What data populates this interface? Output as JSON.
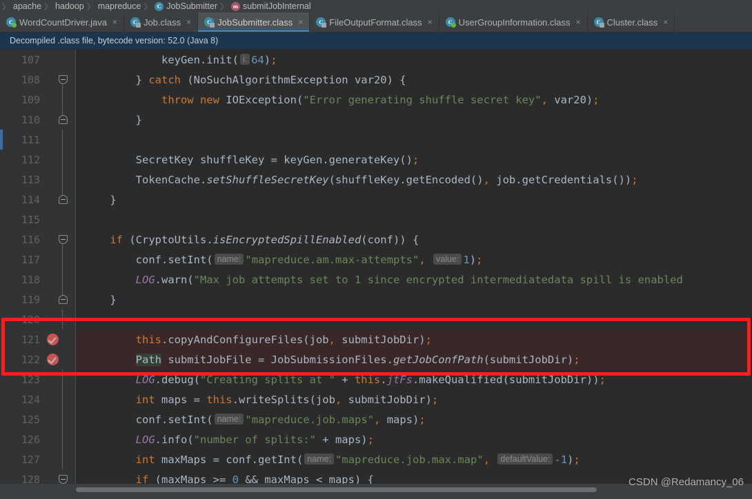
{
  "breadcrumb": {
    "items": [
      {
        "label": "apache",
        "icon": ""
      },
      {
        "label": "hadoop",
        "icon": ""
      },
      {
        "label": "mapreduce",
        "icon": ""
      },
      {
        "label": "JobSubmitter",
        "icon": "class-icon",
        "glyph": "C"
      },
      {
        "label": "submitJobInternal",
        "icon": "method-icon",
        "glyph": "m"
      }
    ],
    "separator": "〉"
  },
  "tabs": [
    {
      "label": "WordCountDriver.java",
      "icon": "java-class-icon",
      "glyph": "C",
      "badge": "green",
      "active": false,
      "close": "×"
    },
    {
      "label": "Job.class",
      "icon": "compiled-class-icon",
      "glyph": "C",
      "badge": "lock",
      "active": false,
      "close": "×"
    },
    {
      "label": "JobSubmitter.class",
      "icon": "compiled-class-icon",
      "glyph": "C",
      "badge": "lock",
      "active": true,
      "close": "×"
    },
    {
      "label": "FileOutputFormat.class",
      "icon": "compiled-class-icon",
      "glyph": "C",
      "badge": "lock",
      "active": false,
      "close": "×"
    },
    {
      "label": "UserGroupInformation.class",
      "icon": "compiled-class-icon",
      "glyph": "C",
      "badge": "green",
      "active": false,
      "close": "×"
    },
    {
      "label": "Cluster.class",
      "icon": "compiled-class-icon",
      "glyph": "C",
      "badge": "lock",
      "active": false,
      "close": "×"
    }
  ],
  "notification": {
    "text": "Decompiled .class file, bytecode version: 52.0 (Java 8)"
  },
  "editor": {
    "lines": [
      {
        "no": "107",
        "fold": "none",
        "bp": false,
        "vcs": false,
        "highlight": false,
        "tokens": [
          {
            "t": "            ",
            "c": "op"
          },
          {
            "t": "keyGen.init(",
            "c": "ident"
          },
          {
            "t": "i:",
            "c": "hint"
          },
          {
            "t": "64",
            "c": "num"
          },
          {
            "t": ")",
            "c": "ident"
          },
          {
            "t": ";",
            "c": "semi"
          }
        ]
      },
      {
        "no": "108",
        "fold": "start",
        "bp": false,
        "vcs": false,
        "highlight": false,
        "tokens": [
          {
            "t": "        } ",
            "c": "op"
          },
          {
            "t": "catch",
            "c": "kw"
          },
          {
            "t": " (NoSuchAlgorithmException var20) {",
            "c": "ident"
          }
        ]
      },
      {
        "no": "109",
        "fold": "line",
        "bp": false,
        "vcs": false,
        "highlight": false,
        "tokens": [
          {
            "t": "            ",
            "c": "op"
          },
          {
            "t": "throw new",
            "c": "kw"
          },
          {
            "t": " IOException(",
            "c": "ident"
          },
          {
            "t": "\"Error generating shuffle secret key\"",
            "c": "str"
          },
          {
            "t": ",",
            "c": "comma"
          },
          {
            "t": " var20)",
            "c": "ident"
          },
          {
            "t": ";",
            "c": "semi"
          }
        ]
      },
      {
        "no": "110",
        "fold": "end",
        "bp": false,
        "vcs": false,
        "highlight": false,
        "tokens": [
          {
            "t": "        }",
            "c": "op"
          }
        ]
      },
      {
        "no": "111",
        "fold": "line",
        "bp": false,
        "vcs": true,
        "highlight": false,
        "tokens": []
      },
      {
        "no": "112",
        "fold": "line",
        "bp": false,
        "vcs": false,
        "highlight": false,
        "tokens": [
          {
            "t": "        SecretKey shuffleKey = keyGen.generateKey()",
            "c": "ident"
          },
          {
            "t": ";",
            "c": "semi"
          }
        ]
      },
      {
        "no": "113",
        "fold": "line",
        "bp": false,
        "vcs": false,
        "highlight": false,
        "tokens": [
          {
            "t": "        TokenCache.",
            "c": "ident"
          },
          {
            "t": "setShuffleSecretKey",
            "c": "stat"
          },
          {
            "t": "(shuffleKey.getEncoded()",
            "c": "ident"
          },
          {
            "t": ",",
            "c": "comma"
          },
          {
            "t": " job.getCredentials())",
            "c": "ident"
          },
          {
            "t": ";",
            "c": "semi"
          }
        ]
      },
      {
        "no": "114",
        "fold": "end",
        "bp": false,
        "vcs": false,
        "highlight": false,
        "tokens": [
          {
            "t": "    }",
            "c": "op"
          }
        ]
      },
      {
        "no": "115",
        "fold": "none",
        "bp": false,
        "vcs": false,
        "highlight": false,
        "tokens": []
      },
      {
        "no": "116",
        "fold": "start",
        "bp": false,
        "vcs": false,
        "highlight": false,
        "tokens": [
          {
            "t": "    ",
            "c": "op"
          },
          {
            "t": "if",
            "c": "kw"
          },
          {
            "t": " (CryptoUtils.",
            "c": "ident"
          },
          {
            "t": "isEncryptedSpillEnabled",
            "c": "stat"
          },
          {
            "t": "(conf)) {",
            "c": "ident"
          }
        ]
      },
      {
        "no": "117",
        "fold": "line",
        "bp": false,
        "vcs": false,
        "highlight": false,
        "tokens": [
          {
            "t": "        conf.setInt(",
            "c": "ident"
          },
          {
            "t": "name:",
            "c": "hint"
          },
          {
            "t": "\"mapreduce.am.max-attempts\"",
            "c": "str"
          },
          {
            "t": ",",
            "c": "comma"
          },
          {
            "t": " ",
            "c": "op"
          },
          {
            "t": "value:",
            "c": "hint"
          },
          {
            "t": "1",
            "c": "num"
          },
          {
            "t": ")",
            "c": "ident"
          },
          {
            "t": ";",
            "c": "semi"
          }
        ]
      },
      {
        "no": "118",
        "fold": "line",
        "bp": false,
        "vcs": false,
        "highlight": false,
        "tokens": [
          {
            "t": "        ",
            "c": "op"
          },
          {
            "t": "LOG",
            "c": "field"
          },
          {
            "t": ".warn(",
            "c": "ident"
          },
          {
            "t": "\"Max job attempts set to 1 since encrypted intermediatedata spill is enabled",
            "c": "str"
          }
        ]
      },
      {
        "no": "119",
        "fold": "end",
        "bp": false,
        "vcs": false,
        "highlight": false,
        "tokens": [
          {
            "t": "    }",
            "c": "op"
          }
        ]
      },
      {
        "no": "120",
        "fold": "line",
        "bp": false,
        "vcs": false,
        "highlight": false,
        "tokens": []
      },
      {
        "no": "121",
        "fold": "none",
        "bp": true,
        "vcs": false,
        "highlight": true,
        "tokens": [
          {
            "t": "        ",
            "c": "op"
          },
          {
            "t": "this",
            "c": "kw"
          },
          {
            "t": ".copyAndConfigureFiles(job",
            "c": "ident"
          },
          {
            "t": ",",
            "c": "comma"
          },
          {
            "t": " submitJobDir)",
            "c": "ident"
          },
          {
            "t": ";",
            "c": "semi"
          }
        ]
      },
      {
        "no": "122",
        "fold": "none",
        "bp": true,
        "vcs": false,
        "highlight": true,
        "tokens": [
          {
            "t": "        ",
            "c": "op"
          },
          {
            "t": "Path",
            "c": "greenhl"
          },
          {
            "t": " submitJobFile = JobSubmissionFiles.",
            "c": "ident"
          },
          {
            "t": "getJobConfPath",
            "c": "stat"
          },
          {
            "t": "(submitJobDir)",
            "c": "ident"
          },
          {
            "t": ";",
            "c": "semi"
          }
        ]
      },
      {
        "no": "123",
        "fold": "line",
        "bp": false,
        "vcs": false,
        "highlight": false,
        "tokens": [
          {
            "t": "        ",
            "c": "op"
          },
          {
            "t": "LOG",
            "c": "field"
          },
          {
            "t": ".debug(",
            "c": "ident"
          },
          {
            "t": "\"Creating splits at \"",
            "c": "str"
          },
          {
            "t": " + ",
            "c": "op"
          },
          {
            "t": "this",
            "c": "kw"
          },
          {
            "t": ".",
            "c": "ident"
          },
          {
            "t": "jtFs",
            "c": "field"
          },
          {
            "t": ".makeQualified(submitJobDir))",
            "c": "ident"
          },
          {
            "t": ";",
            "c": "semi"
          }
        ]
      },
      {
        "no": "124",
        "fold": "line",
        "bp": false,
        "vcs": false,
        "highlight": false,
        "tokens": [
          {
            "t": "        ",
            "c": "op"
          },
          {
            "t": "int",
            "c": "kw"
          },
          {
            "t": " maps = ",
            "c": "ident"
          },
          {
            "t": "this",
            "c": "kw"
          },
          {
            "t": ".writeSplits(job",
            "c": "ident"
          },
          {
            "t": ",",
            "c": "comma"
          },
          {
            "t": " submitJobDir)",
            "c": "ident"
          },
          {
            "t": ";",
            "c": "semi"
          }
        ]
      },
      {
        "no": "125",
        "fold": "line",
        "bp": false,
        "vcs": false,
        "highlight": false,
        "tokens": [
          {
            "t": "        conf.setInt(",
            "c": "ident"
          },
          {
            "t": "name:",
            "c": "hint"
          },
          {
            "t": "\"mapreduce.job.maps\"",
            "c": "str"
          },
          {
            "t": ",",
            "c": "comma"
          },
          {
            "t": " maps)",
            "c": "ident"
          },
          {
            "t": ";",
            "c": "semi"
          }
        ]
      },
      {
        "no": "126",
        "fold": "line",
        "bp": false,
        "vcs": false,
        "highlight": false,
        "tokens": [
          {
            "t": "        ",
            "c": "op"
          },
          {
            "t": "LOG",
            "c": "field"
          },
          {
            "t": ".info(",
            "c": "ident"
          },
          {
            "t": "\"number of splits:\"",
            "c": "str"
          },
          {
            "t": " + ",
            "c": "op"
          },
          {
            "t": "maps)",
            "c": "ident"
          },
          {
            "t": ";",
            "c": "semi"
          }
        ]
      },
      {
        "no": "127",
        "fold": "line",
        "bp": false,
        "vcs": false,
        "highlight": false,
        "tokens": [
          {
            "t": "        ",
            "c": "op"
          },
          {
            "t": "int",
            "c": "kw"
          },
          {
            "t": " maxMaps = conf.getInt(",
            "c": "ident"
          },
          {
            "t": "name:",
            "c": "hint"
          },
          {
            "t": "\"mapreduce.job.max.map\"",
            "c": "str"
          },
          {
            "t": ",",
            "c": "comma"
          },
          {
            "t": " ",
            "c": "op"
          },
          {
            "t": "defaultValue:",
            "c": "hint"
          },
          {
            "t": "-1",
            "c": "num"
          },
          {
            "t": ")",
            "c": "ident"
          },
          {
            "t": ";",
            "c": "semi"
          }
        ]
      },
      {
        "no": "128",
        "fold": "start",
        "bp": false,
        "vcs": false,
        "highlight": false,
        "tokens": [
          {
            "t": "        ",
            "c": "op"
          },
          {
            "t": "if",
            "c": "kw"
          },
          {
            "t": " (maxMaps >= ",
            "c": "ident"
          },
          {
            "t": "0",
            "c": "num"
          },
          {
            "t": " && maxMaps < maps) {",
            "c": "ident"
          }
        ]
      }
    ]
  },
  "annotation": {
    "highlight_color": "#fc1d1d"
  },
  "watermark": {
    "text": "CSDN @Redamancy_06"
  }
}
